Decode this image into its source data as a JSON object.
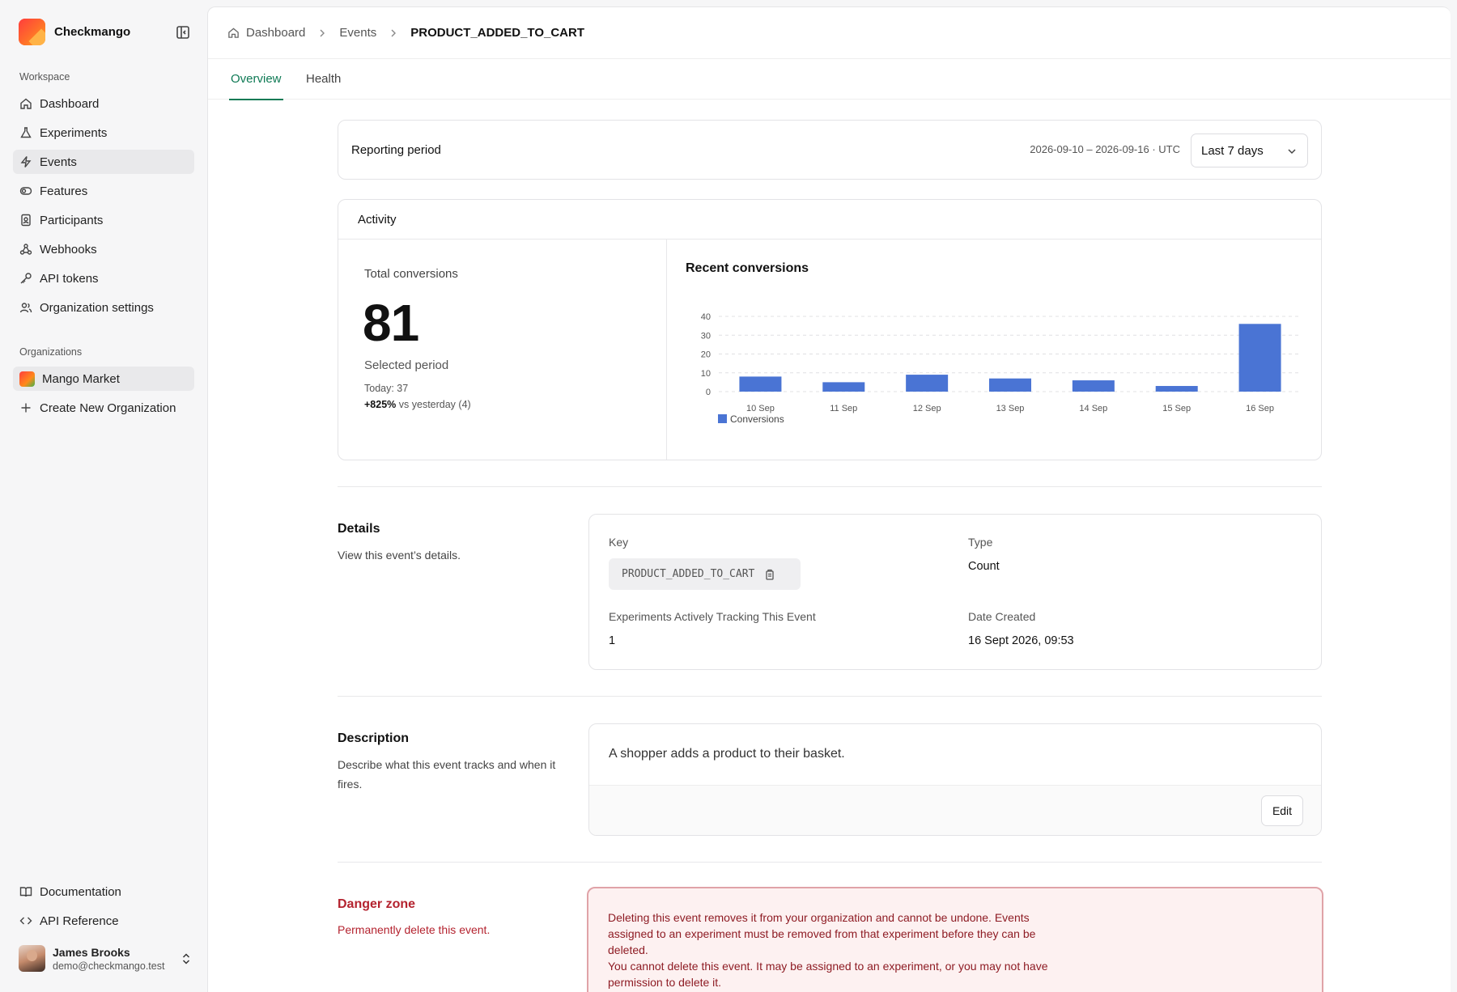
{
  "app": {
    "name": "Checkmango"
  },
  "sidebar": {
    "workspace_label": "Workspace",
    "items": [
      {
        "label": "Dashboard",
        "icon": "home-icon"
      },
      {
        "label": "Experiments",
        "icon": "flask-icon"
      },
      {
        "label": "Events",
        "icon": "bolt-icon",
        "active": true
      },
      {
        "label": "Features",
        "icon": "toggle-icon"
      },
      {
        "label": "Participants",
        "icon": "badge-icon"
      },
      {
        "label": "Webhooks",
        "icon": "webhook-icon"
      },
      {
        "label": "API tokens",
        "icon": "key-icon"
      },
      {
        "label": "Organization settings",
        "icon": "users-icon"
      }
    ],
    "organizations_label": "Organizations",
    "organizations": [
      {
        "label": "Mango Market"
      }
    ],
    "create_org_label": "Create New Organization",
    "footer_links": [
      {
        "label": "Documentation",
        "icon": "book-icon"
      },
      {
        "label": "API Reference",
        "icon": "code-icon"
      }
    ],
    "user": {
      "name": "James Brooks",
      "email": "demo@checkmango.test"
    }
  },
  "breadcrumb": [
    "Dashboard",
    "Events",
    "PRODUCT_ADDED_TO_CART"
  ],
  "tabs": [
    "Overview",
    "Health"
  ],
  "reporting": {
    "label": "Reporting period",
    "range": "2026-09-10 – 2026-09-16 · UTC",
    "selected": "Last 7 days"
  },
  "activity": {
    "title": "Activity",
    "total_label": "Total conversions",
    "total_value": "81",
    "period_label": "Selected period",
    "today": "Today: 37",
    "change": "+825%",
    "change_suffix": "vs yesterday (4)"
  },
  "chart_data": {
    "type": "bar",
    "title": "Recent conversions",
    "categories": [
      "10 Sep",
      "11 Sep",
      "12 Sep",
      "13 Sep",
      "14 Sep",
      "15 Sep",
      "16 Sep"
    ],
    "series": [
      {
        "name": "Conversions",
        "values": [
          8,
          5,
          9,
          7,
          6,
          3,
          36
        ]
      }
    ],
    "yticks": [
      0,
      10,
      20,
      30,
      40
    ],
    "ylim": [
      0,
      40
    ],
    "grid": true,
    "legend": "bottom-left",
    "color": "#4a74d4"
  },
  "details": {
    "title": "Details",
    "description": "View this event’s details.",
    "key_label": "Key",
    "key_value": "PRODUCT_ADDED_TO_CART",
    "type_label": "Type",
    "type_value": "Count",
    "experiments_label": "Experiments Actively Tracking This Event",
    "experiments_value": "1",
    "date_label": "Date Created",
    "date_value": "16 Sept 2026, 09:53"
  },
  "description_section": {
    "title": "Description",
    "description": "Describe what this event tracks and when it fires.",
    "text": "A shopper adds a product to their basket.",
    "edit_label": "Edit"
  },
  "danger": {
    "title": "Danger zone",
    "description": "Permanently delete this event.",
    "text1": "Deleting this event removes it from your organization and cannot be undone. Events assigned to an experiment must be removed from that experiment before they can be deleted.",
    "text2": "You cannot delete this event. It may be assigned to an experiment, or you may not have permission to delete it."
  }
}
